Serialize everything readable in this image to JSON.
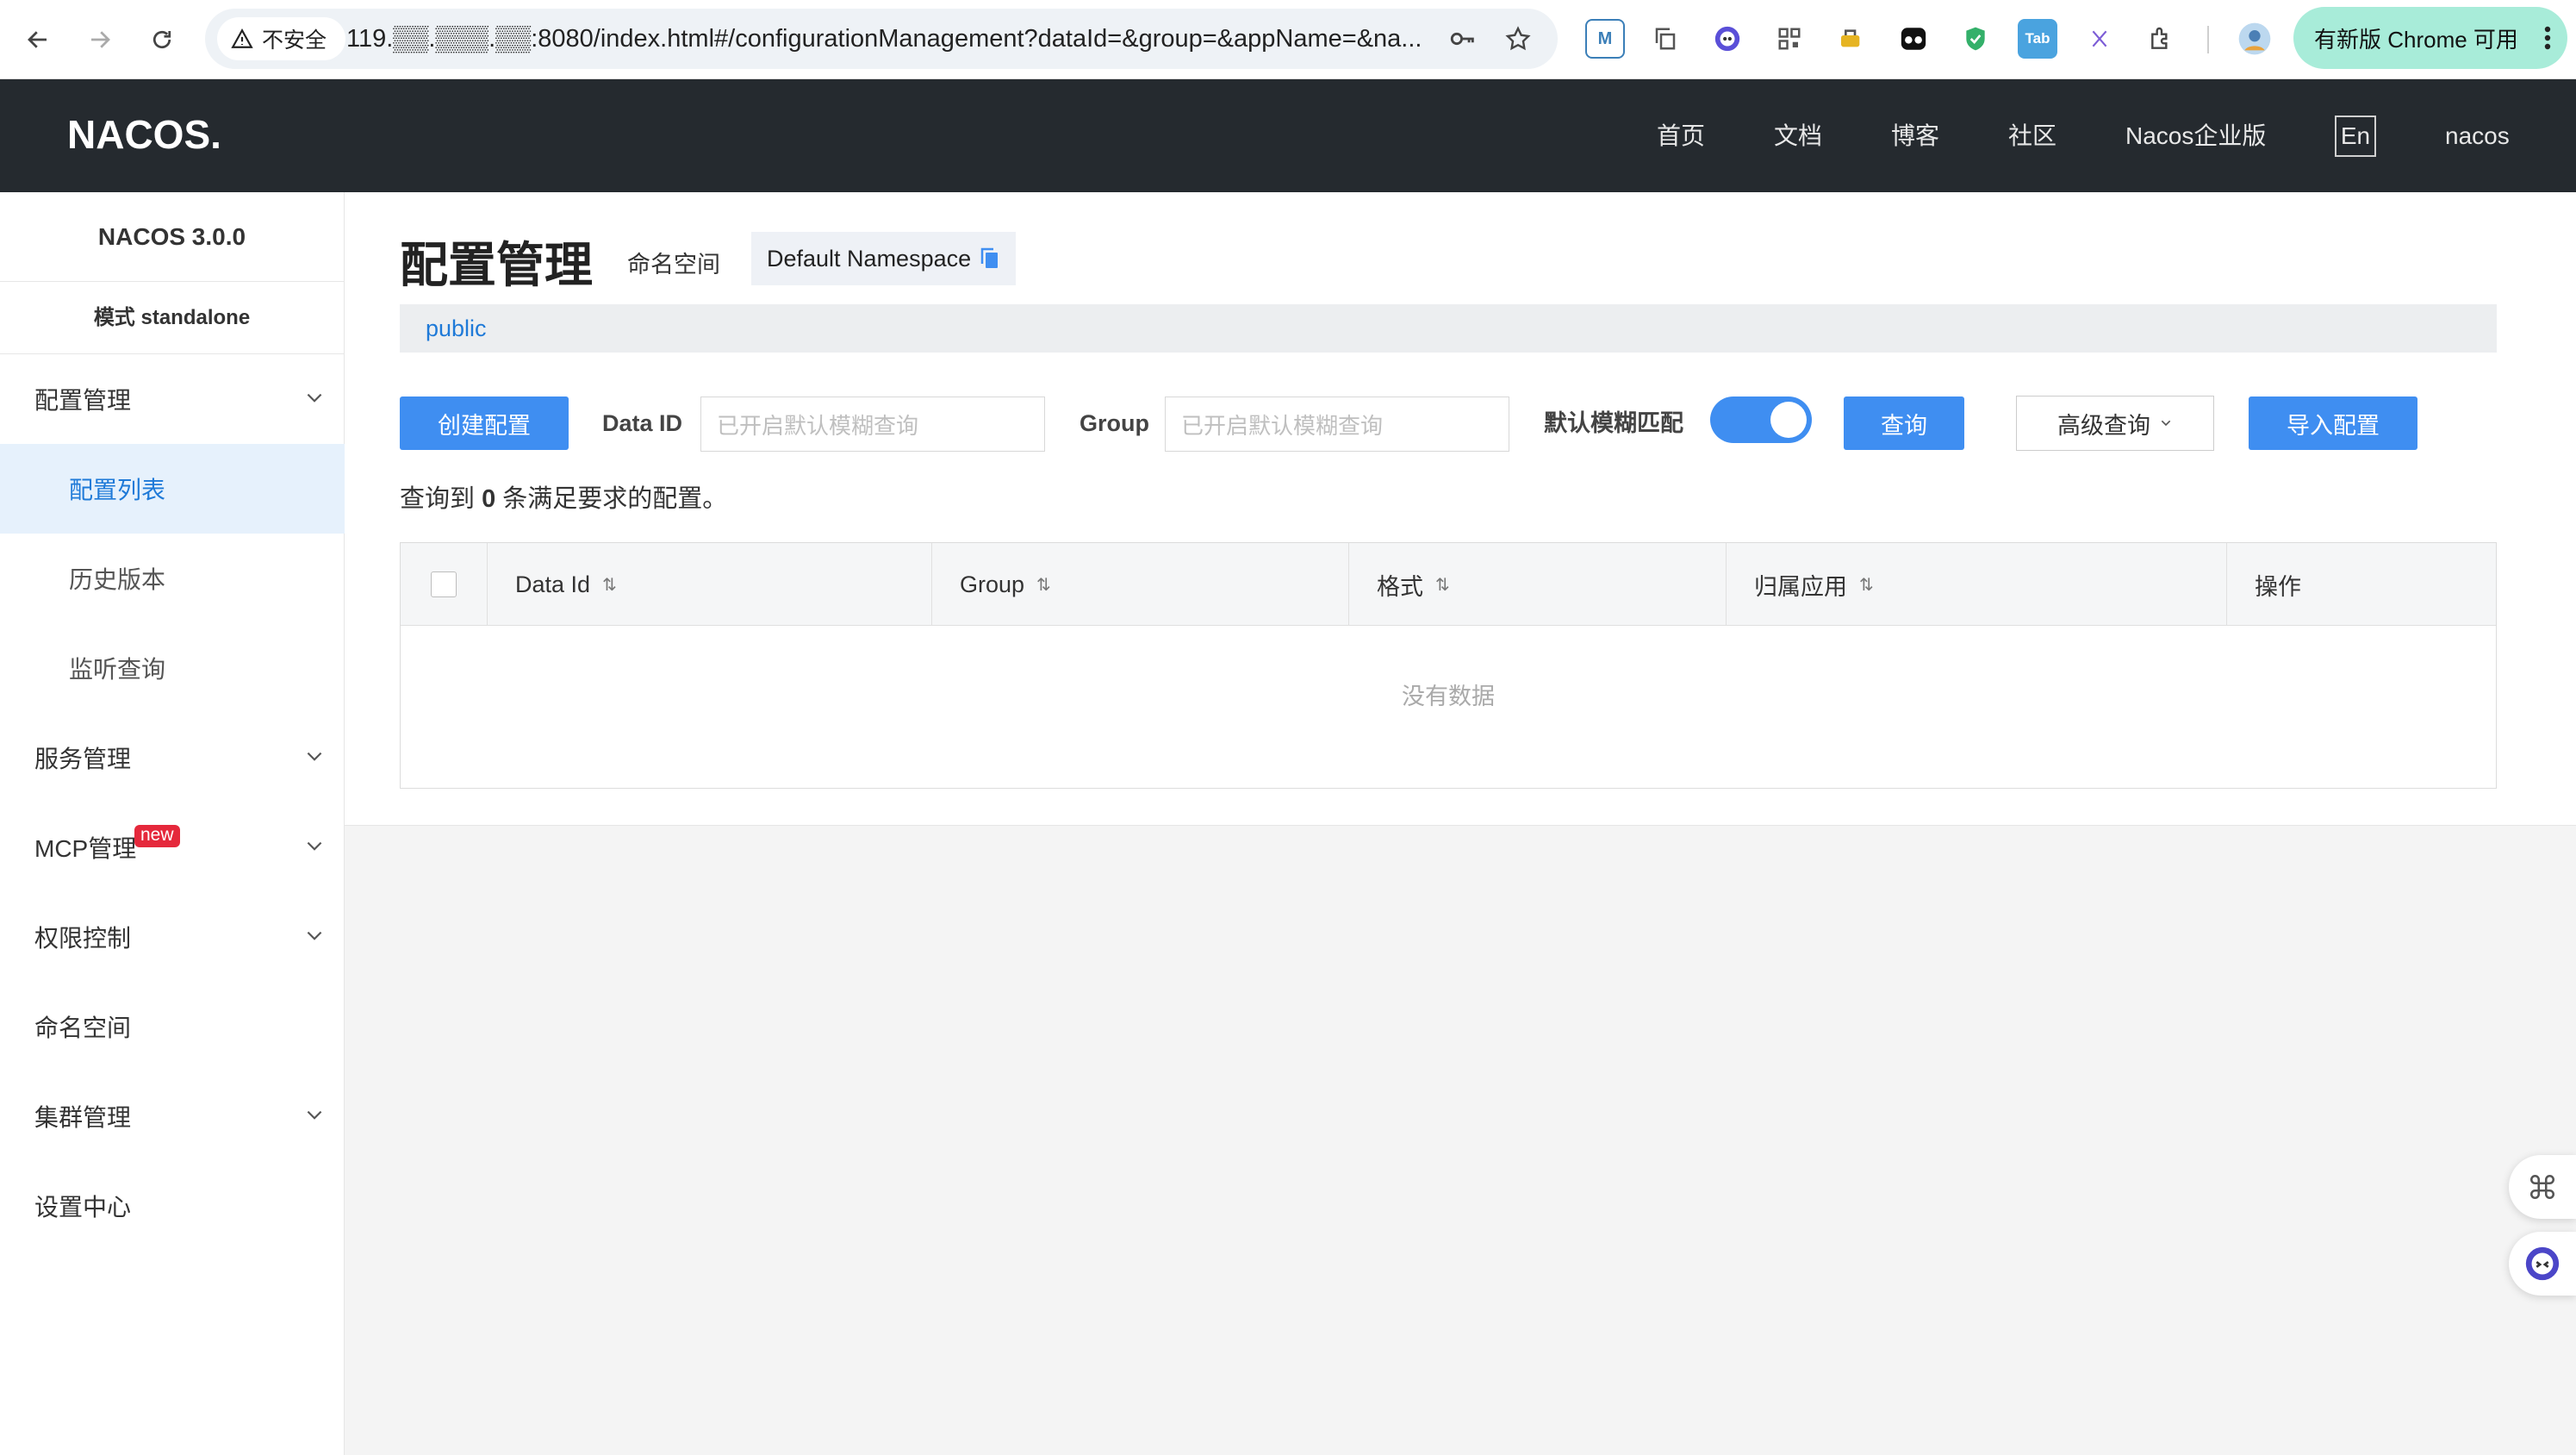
{
  "browser": {
    "insecure_label": "不安全",
    "url": "119.▒▒.▒▒▒.▒▒:8080/index.html#/configurationManagement?dataId=&group=&appName=&na...",
    "update_label": "有新版 Chrome 可用",
    "ext_tab_label": "Tab",
    "ext_m_label": "M"
  },
  "header": {
    "logo_text": "NACOS.",
    "nav": [
      "首页",
      "文档",
      "博客",
      "社区",
      "Nacos企业版"
    ],
    "lang_label": "En",
    "user_label": "nacos",
    "bg_color": "#252a2f"
  },
  "sidebar": {
    "version": "NACOS 3.0.0",
    "mode": "模式 standalone",
    "items": [
      {
        "label": "配置管理"
      },
      {
        "label": "配置列表"
      },
      {
        "label": "历史版本"
      },
      {
        "label": "监听查询"
      },
      {
        "label": "服务管理"
      },
      {
        "label": "MCP管理",
        "badge": "new"
      },
      {
        "label": "权限控制"
      },
      {
        "label": "命名空间"
      },
      {
        "label": "集群管理"
      },
      {
        "label": "设置中心"
      }
    ]
  },
  "page": {
    "title": "配置管理",
    "namespace_label": "命名空间",
    "namespace_value": "Default Namespace",
    "namespace_tab": "public",
    "create_button": "创建配置",
    "dataid_label": "Data ID",
    "dataid_placeholder": "已开启默认模糊查询",
    "group_label": "Group",
    "group_placeholder": "已开启默认模糊查询",
    "fuzzy_label": "默认模糊匹配",
    "fuzzy_enabled": true,
    "query_button": "查询",
    "advanced_button": "高级查询",
    "import_button": "导入配置",
    "result_prefix": "查询到",
    "result_count": "0",
    "result_suffix": "条满足要求的配置。",
    "accent_color": "#3f8ef1"
  },
  "table": {
    "columns": [
      "Data Id",
      "Group",
      "格式",
      "归属应用",
      "操作"
    ],
    "empty_text": "没有数据"
  }
}
